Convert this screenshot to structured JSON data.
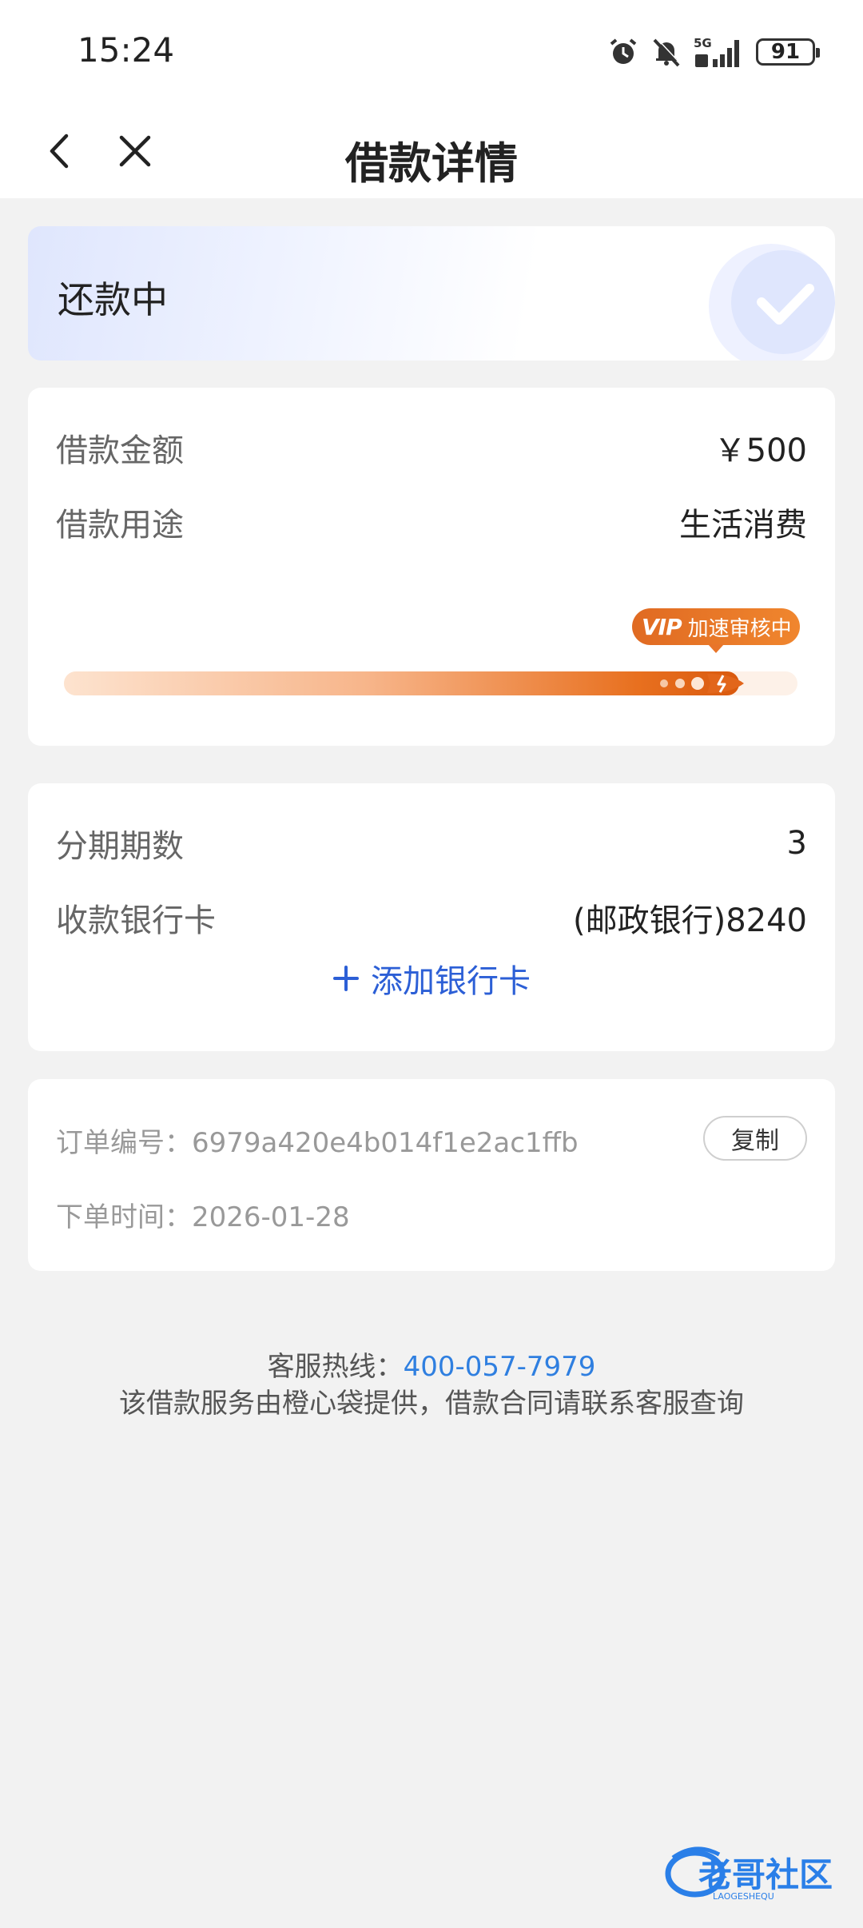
{
  "status_bar": {
    "time": "15:24",
    "battery": "91",
    "network": "5G"
  },
  "nav": {
    "title": "借款详情",
    "back_icon": "chevron-left-icon",
    "close_icon": "close-icon"
  },
  "status_card": {
    "text": "还款中"
  },
  "loan_card": {
    "amount_label": "借款金额",
    "amount_value": "￥500",
    "purpose_label": "借款用途",
    "purpose_value": "生活消费",
    "vip_mark": "VIP",
    "vip_text": "加速审核中",
    "progress": 0.92
  },
  "installment_card": {
    "periods_label": "分期期数",
    "periods_value": "3",
    "bank_label": "收款银行卡",
    "bank_value": "(邮政银行)8240",
    "add_card_label": "添加银行卡"
  },
  "order_card": {
    "order_no_label": "订单编号：",
    "order_no": "6979a420e4b014f1e2ac1ffb",
    "copy_label": "复制",
    "order_time_label": "下单时间：",
    "order_time": "2026-01-28"
  },
  "footer": {
    "hotline_label": "客服热线：",
    "hotline": "400-057-7979",
    "disclaimer": "该借款服务由橙心袋提供，借款合同请联系客服查询"
  },
  "watermark": {
    "text": "老哥社区",
    "sub": "LAOGESHEQU"
  },
  "colors": {
    "accent_blue": "#2c5fd6",
    "hotline_blue": "#2f7fe0",
    "vip_orange": "#e8701f"
  }
}
